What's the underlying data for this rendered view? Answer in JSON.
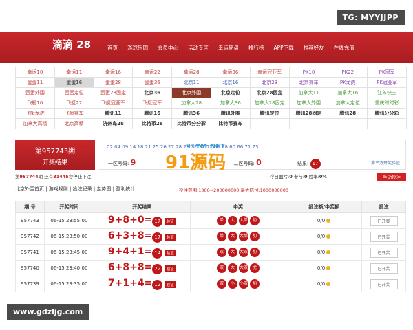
{
  "watermark_top": "TG: MYYJJPP",
  "watermark_bottom": "www.gdzljg.com",
  "site_watermark": "91源码",
  "site_watermark_sub": "91YM.NET",
  "logo": "滴滴 28",
  "nav": [
    "首页",
    "游戏乐园",
    "会员中心",
    "活动专区",
    "幸运轮盘",
    "排行榜",
    "APP下载",
    "推荐好友",
    "在线充值"
  ],
  "games": [
    [
      "幸运10",
      "幸运11",
      "幸运16",
      "幸运22",
      "幸运28",
      "幸运36",
      "幸运冠亚军",
      "PK10",
      "PK22",
      "PK冠军"
    ],
    [
      "蛋蛋11",
      "蛋蛋16",
      "蛋蛋28",
      "蛋蛋36",
      "北京11",
      "北京16",
      "北京28",
      "北京赛车",
      "PK龙虎",
      "PK冠亚军"
    ],
    [
      "蛋蛋外围",
      "蛋蛋定位",
      "蛋蛋28固定",
      "北京36",
      "北京外围",
      "北京定位",
      "北京28固定",
      "加拿大11",
      "加拿大16",
      "江苏快三"
    ],
    [
      "飞艇10",
      "飞艇22",
      "飞艇冠亚军",
      "飞艇冠军",
      "加拿大28",
      "加拿大36",
      "加拿大28固定",
      "加拿大外围",
      "加拿大定位",
      "重庆时时彩"
    ],
    [
      "飞艇龙虎",
      "飞艇赛车",
      "腾讯11",
      "腾讯16",
      "腾讯36",
      "腾讯外围",
      "腾讯定位",
      "腾讯28固定",
      "腾讯28",
      "腾讯分分彩"
    ],
    [
      "加拿大高精",
      "北京高精",
      "济州岛28",
      "比特币28",
      "比特币分分彩",
      "比特币赛车",
      "",
      "",
      "",
      ""
    ]
  ],
  "period": {
    "line1": "第957743期",
    "line2": "开奖结果"
  },
  "draw_numbers": "02 04 09 14 18 21 25 26 27 28 29 32 34 52 53 58 60 66 71 73",
  "zone1_label": "一区号码:",
  "zone1_value": "9",
  "zone2_label": "二区号码:",
  "zone2_value": "0",
  "result_label": "结果:",
  "result_value": "17",
  "next_link": "第三方开奖验证",
  "info": {
    "prefix": "第",
    "period": "957744",
    "mid": "期 还有",
    "seconds": "31445",
    "suffix": "秒停止下注!",
    "stats": "今日盈亏:",
    "stat_val1": "0",
    "stat_lbl2": "参与:",
    "stat_val2": "0",
    "stat_lbl3": "胜率:",
    "stat_val3": "0%",
    "auto_btn": "手动投注"
  },
  "links": "北京外围首页 | 游戏规则 | 投注记录 | 走势图 | 盈利统计",
  "bet_range": "投注范围:1000~200000000  最大赔付:1000000000",
  "table": {
    "headers": [
      "期 号",
      "开奖时间",
      "开奖结果",
      "中奖",
      "投注额/中奖额",
      "投注"
    ],
    "verify": "验证",
    "done": "已开奖",
    "rows": [
      {
        "id": "957743",
        "time": "06-15 23:55:00",
        "a": "9",
        "b": "8",
        "c": "0",
        "sum": "17",
        "r": [
          "单",
          "大",
          "大单",
          "豹"
        ],
        "amt": "0/0"
      },
      {
        "id": "957742",
        "time": "06-15 23:50:00",
        "a": "6",
        "b": "3",
        "c": "8",
        "sum": "17",
        "r": [
          "单",
          "大",
          "大单",
          "豹"
        ],
        "amt": "0/0"
      },
      {
        "id": "957741",
        "time": "06-15 23:45:00",
        "a": "9",
        "b": "4",
        "c": "1",
        "sum": "14",
        "r": [
          "双",
          "大",
          "大双",
          "豹"
        ],
        "amt": "0/0"
      },
      {
        "id": "957740",
        "time": "06-15 23:40:00",
        "a": "6",
        "b": "8",
        "c": "8",
        "sum": "22",
        "r": [
          "双",
          "大",
          "大双",
          "虎"
        ],
        "amt": "0/0"
      },
      {
        "id": "957739",
        "time": "06-15 23:35:00",
        "a": "7",
        "b": "1",
        "c": "4",
        "sum": "12",
        "r": [
          "双",
          "小",
          "小双",
          "豹"
        ],
        "amt": "0/0"
      }
    ]
  }
}
